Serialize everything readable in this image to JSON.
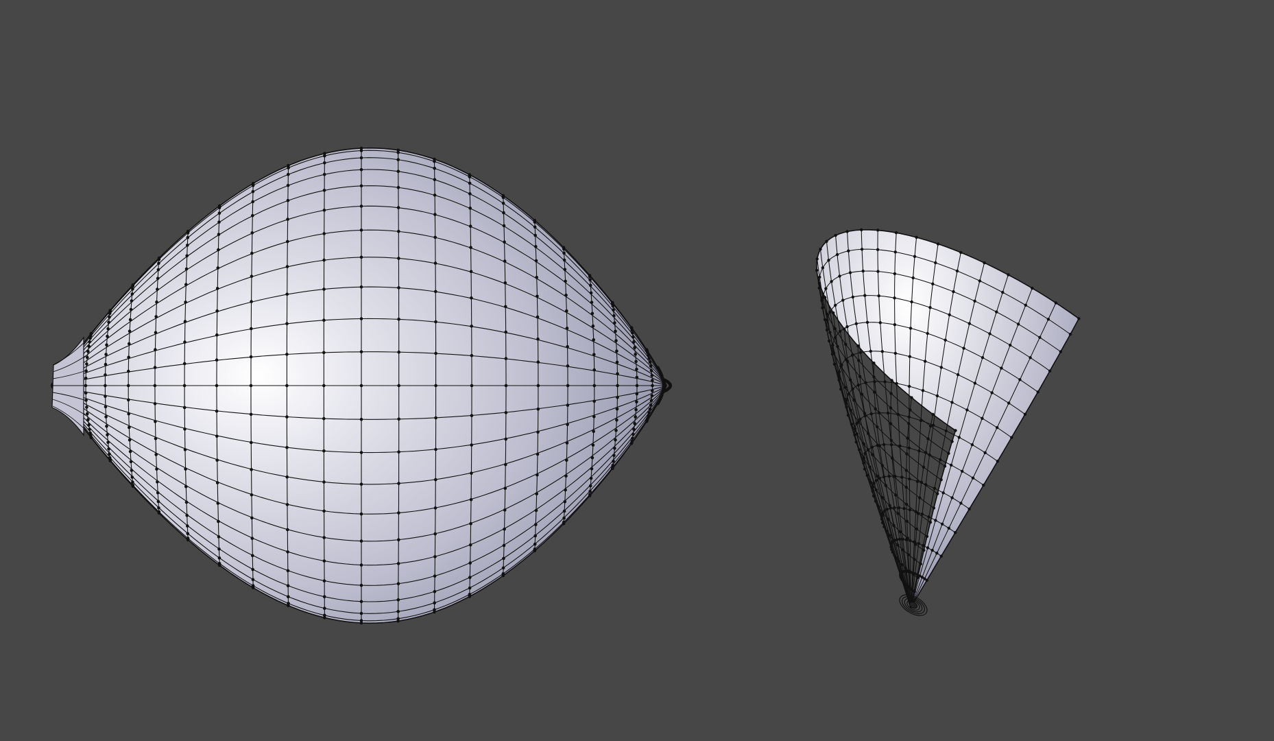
{
  "viewport": {
    "background": "#474747"
  },
  "objects": [
    {
      "id": "egg-mesh",
      "kind": "mesh",
      "view": "side",
      "shading": "solid",
      "wireframe": true,
      "base_color": "#c9c9d8",
      "highlight_color": "#ffffff",
      "shadow_color": "#8a8aa2",
      "wire_color": "#111111"
    },
    {
      "id": "half-shell-mesh",
      "kind": "mesh",
      "view": "tilted",
      "shading": "solid",
      "wireframe": true,
      "base_color": "#c9c9d8",
      "highlight_color": "#ffffff",
      "shadow_color": "#8a8aa2",
      "wire_color": "#111111"
    }
  ]
}
